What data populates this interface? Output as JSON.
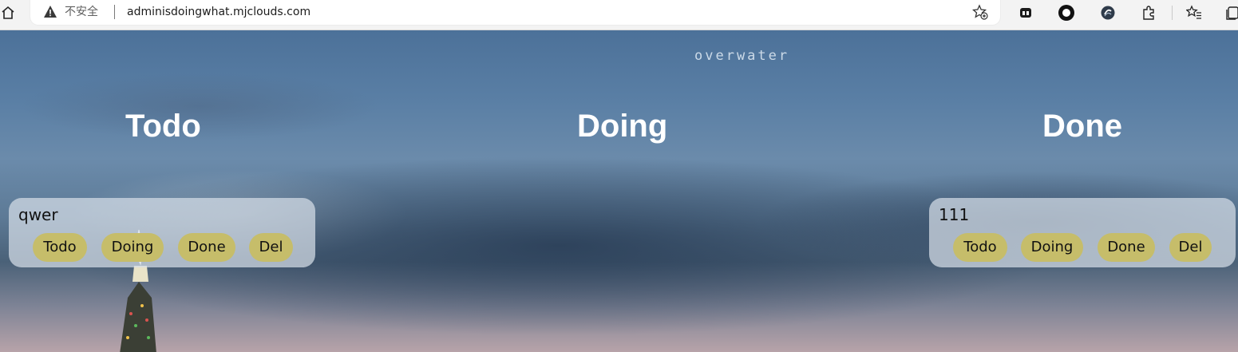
{
  "browser": {
    "security_label": "不安全",
    "url": "adminisdoingwhat.mjclouds.com",
    "icons": {
      "home": "home-icon",
      "warning": "warning-triangle-icon",
      "favorite": "add-favorite-icon",
      "extensions": [
        "extension-1-icon",
        "extension-2-icon",
        "extension-3-icon",
        "extensions-puzzle-icon",
        "favorites-icon",
        "collections-icon"
      ]
    }
  },
  "brand": "overwater",
  "columns": [
    {
      "title": "Todo"
    },
    {
      "title": "Doing"
    },
    {
      "title": "Done"
    }
  ],
  "cards": [
    {
      "column": "Todo",
      "text": "qwer",
      "buttons": [
        "Todo",
        "Doing",
        "Done",
        "Del"
      ]
    },
    {
      "column": "Done",
      "text": "111",
      "buttons": [
        "Todo",
        "Doing",
        "Done",
        "Del"
      ]
    }
  ],
  "colors": {
    "button_bg": "#c6bd6a",
    "card_bg": "rgba(214,222,232,0.72)",
    "title": "#ffffff"
  }
}
